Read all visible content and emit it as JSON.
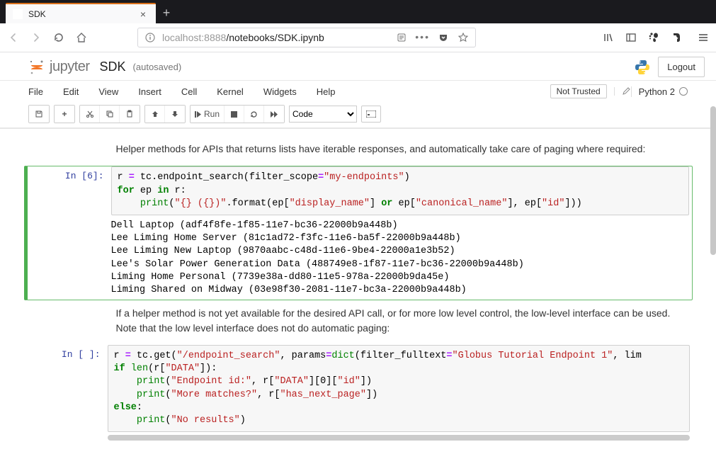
{
  "browser": {
    "tab_title": "SDK",
    "url_host": "localhost",
    "url_port": ":8888",
    "url_path": "/notebooks/SDK.ipynb"
  },
  "jupyter": {
    "logo_text": "jupyter",
    "notebook_name": "SDK",
    "autosave": "(autosaved)",
    "logout": "Logout",
    "not_trusted": "Not Trusted",
    "kernel_name": "Python 2",
    "menu": {
      "file": "File",
      "edit": "Edit",
      "view": "View",
      "insert": "Insert",
      "cell": "Cell",
      "kernel": "Kernel",
      "widgets": "Widgets",
      "help": "Help"
    },
    "toolbar": {
      "run": "Run",
      "cell_type": "Code"
    }
  },
  "content": {
    "para1": "Helper methods for APIs that returns lists have iterable responses, and automatically take care of paging where required:",
    "prompt_6": "In [6]:",
    "code_6_tokens": [
      {
        "t": "r ",
        "c": "k-name"
      },
      {
        "t": "=",
        "c": "k-op"
      },
      {
        "t": " tc.endpoint_search(filter_scope",
        "c": "k-name"
      },
      {
        "t": "=",
        "c": "k-op"
      },
      {
        "t": "\"my-endpoints\"",
        "c": "k-str"
      },
      {
        "t": ")",
        "c": "k-name"
      },
      {
        "t": "\n",
        "c": ""
      },
      {
        "t": "for",
        "c": "k-kw"
      },
      {
        "t": " ep ",
        "c": "k-name"
      },
      {
        "t": "in",
        "c": "k-kw"
      },
      {
        "t": " r:",
        "c": "k-name"
      },
      {
        "t": "\n",
        "c": ""
      },
      {
        "t": "    ",
        "c": ""
      },
      {
        "t": "print",
        "c": "k-builtin"
      },
      {
        "t": "(",
        "c": "k-name"
      },
      {
        "t": "\"{} ({})\"",
        "c": "k-str"
      },
      {
        "t": ".format(ep[",
        "c": "k-name"
      },
      {
        "t": "\"display_name\"",
        "c": "k-str"
      },
      {
        "t": "] ",
        "c": "k-name"
      },
      {
        "t": "or",
        "c": "k-kw"
      },
      {
        "t": " ep[",
        "c": "k-name"
      },
      {
        "t": "\"canonical_name\"",
        "c": "k-str"
      },
      {
        "t": "], ep[",
        "c": "k-name"
      },
      {
        "t": "\"id\"",
        "c": "k-str"
      },
      {
        "t": "]))",
        "c": "k-name"
      }
    ],
    "output_6": "Dell Laptop (adf4f8fe-1f85-11e7-bc36-22000b9a448b)\nLee Liming Home Server (81c1ad72-f3fc-11e6-ba5f-22000b9a448b)\nLee Liming New Laptop (9870aabc-c48d-11e6-9be4-22000a1e3b52)\nLee's Solar Power Generation Data (488749e8-1f87-11e7-bc36-22000b9a448b)\nLiming Home Personal (7739e38a-dd80-11e5-978a-22000b9da45e)\nLiming Shared on Midway (03e98f30-2081-11e7-bc3a-22000b9a448b)",
    "para2": "If a helper method is not yet available for the desired API call, or for more low level control, the low-level interface can be used. Note that the low level interface does not do automatic paging:",
    "prompt_empty": "In [ ]:",
    "code_7_tokens": [
      {
        "t": "r ",
        "c": "k-name"
      },
      {
        "t": "=",
        "c": "k-op"
      },
      {
        "t": " tc.get(",
        "c": "k-name"
      },
      {
        "t": "\"/endpoint_search\"",
        "c": "k-str"
      },
      {
        "t": ", params",
        "c": "k-name"
      },
      {
        "t": "=",
        "c": "k-op"
      },
      {
        "t": "dict",
        "c": "k-builtin"
      },
      {
        "t": "(filter_fulltext",
        "c": "k-name"
      },
      {
        "t": "=",
        "c": "k-op"
      },
      {
        "t": "\"Globus Tutorial Endpoint 1\"",
        "c": "k-str"
      },
      {
        "t": ", lim",
        "c": "k-name"
      },
      {
        "t": "\n",
        "c": ""
      },
      {
        "t": "if",
        "c": "k-kw"
      },
      {
        "t": " ",
        "c": ""
      },
      {
        "t": "len",
        "c": "k-builtin"
      },
      {
        "t": "(r[",
        "c": "k-name"
      },
      {
        "t": "\"DATA\"",
        "c": "k-str"
      },
      {
        "t": "]):",
        "c": "k-name"
      },
      {
        "t": "\n",
        "c": ""
      },
      {
        "t": "    ",
        "c": ""
      },
      {
        "t": "print",
        "c": "k-builtin"
      },
      {
        "t": "(",
        "c": "k-name"
      },
      {
        "t": "\"Endpoint id:\"",
        "c": "k-str"
      },
      {
        "t": ", r[",
        "c": "k-name"
      },
      {
        "t": "\"DATA\"",
        "c": "k-str"
      },
      {
        "t": "][",
        "c": "k-name"
      },
      {
        "t": "0",
        "c": "k-num"
      },
      {
        "t": "][",
        "c": "k-name"
      },
      {
        "t": "\"id\"",
        "c": "k-str"
      },
      {
        "t": "])",
        "c": "k-name"
      },
      {
        "t": "\n",
        "c": ""
      },
      {
        "t": "    ",
        "c": ""
      },
      {
        "t": "print",
        "c": "k-builtin"
      },
      {
        "t": "(",
        "c": "k-name"
      },
      {
        "t": "\"More matches?\"",
        "c": "k-str"
      },
      {
        "t": ", r[",
        "c": "k-name"
      },
      {
        "t": "\"has_next_page\"",
        "c": "k-str"
      },
      {
        "t": "])",
        "c": "k-name"
      },
      {
        "t": "\n",
        "c": ""
      },
      {
        "t": "else",
        "c": "k-kw"
      },
      {
        "t": ":",
        "c": "k-name"
      },
      {
        "t": "\n",
        "c": ""
      },
      {
        "t": "    ",
        "c": ""
      },
      {
        "t": "print",
        "c": "k-builtin"
      },
      {
        "t": "(",
        "c": "k-name"
      },
      {
        "t": "\"No results\"",
        "c": "k-str"
      },
      {
        "t": ")",
        "c": "k-name"
      }
    ]
  }
}
